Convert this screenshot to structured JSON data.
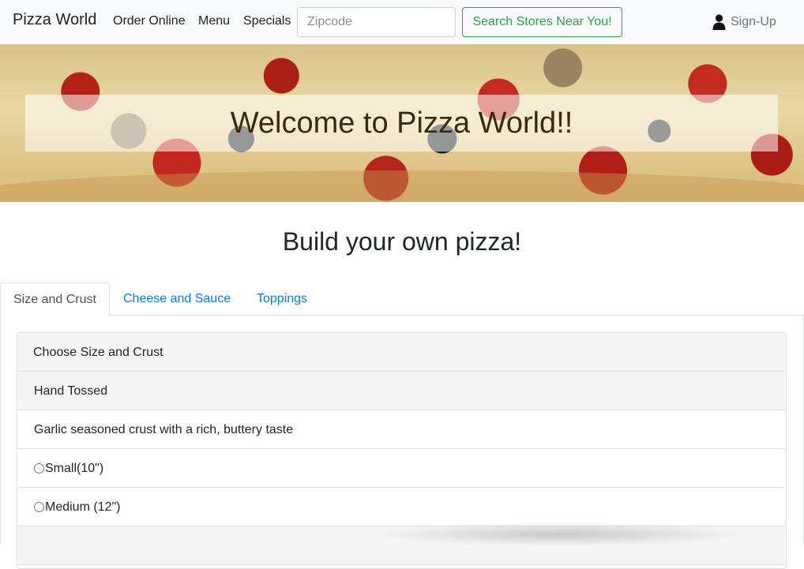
{
  "navbar": {
    "brand": "Pizza World",
    "links": [
      "Order Online",
      "Menu",
      "Specials"
    ],
    "zip_placeholder": "Zipcode",
    "search_label": "Search Stores Near You!",
    "signup_label": "Sign-Up",
    "signup_icon": "user-icon"
  },
  "hero": {
    "title": "Welcome to Pizza World!!"
  },
  "builder": {
    "title": "Build your own pizza!",
    "tabs": [
      {
        "label": "Size and Crust",
        "active": true
      },
      {
        "label": "Cheese and Sauce",
        "active": false
      },
      {
        "label": "Toppings",
        "active": false
      }
    ],
    "card_header": "Choose Size and Crust",
    "crust_name": "Hand Tossed",
    "crust_description": "Garlic seasoned crust with a rich, buttery taste",
    "size_options": [
      "Small(10\")",
      "Medium (12\")"
    ]
  },
  "colors": {
    "link": "#007bff",
    "success": "#28a745",
    "navbar_bg": "#f8f9fa"
  }
}
